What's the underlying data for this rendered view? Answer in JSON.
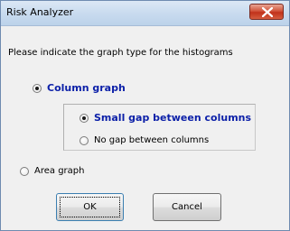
{
  "window": {
    "title": "Risk Analyzer"
  },
  "dialog": {
    "prompt": "Please indicate the graph type for the histograms",
    "options": {
      "column_graph": {
        "label": "Column graph",
        "checked": true
      },
      "small_gap": {
        "label": "Small gap between columns",
        "checked": true
      },
      "no_gap": {
        "label": "No gap between columns",
        "checked": false
      },
      "area_graph": {
        "label": "Area graph",
        "checked": false
      }
    },
    "buttons": {
      "ok_label": "OK",
      "cancel_label": "Cancel"
    }
  },
  "icons": {
    "close": "close-icon",
    "radio": "radio-button"
  },
  "colors": {
    "selected_label": "#0b1fa8",
    "close_button": "#c1321b",
    "titlebar": "#c9dbef"
  }
}
